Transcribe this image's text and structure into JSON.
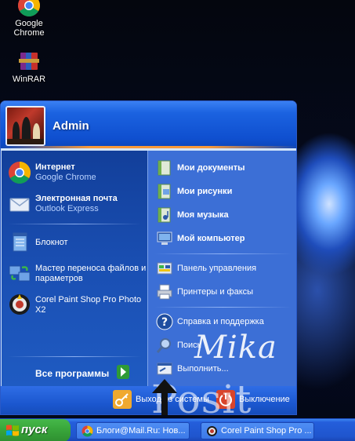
{
  "desktop": {
    "icons": [
      {
        "label": "Google Chrome"
      },
      {
        "label": "WinRAR"
      }
    ]
  },
  "start_menu": {
    "user": {
      "name": "Admin"
    },
    "left": {
      "internet": {
        "title": "Интернет",
        "sub": "Google Chrome"
      },
      "email": {
        "title": "Электронная почта",
        "sub": "Outlook Express"
      },
      "notepad": {
        "title": "Блокнот"
      },
      "transfer_wizard": {
        "line1": "Мастер переноса файлов и",
        "line2": "параметров"
      },
      "corel": {
        "line1": "Corel Paint Shop Pro Photo",
        "line2": "X2"
      },
      "all_programs": "Все программы"
    },
    "right": {
      "my_documents": "Мои документы",
      "my_pictures": "Мои рисунки",
      "my_music": "Моя музыка",
      "my_computer": "Мой компьютер",
      "control_panel": "Панель управления",
      "printers": "Принтеры и факсы",
      "help": "Справка и поддержка",
      "search": "Поиск",
      "run": "Выполнить..."
    },
    "footer": {
      "logoff_label": "Выход из системы",
      "shutdown_label": "Выключение"
    }
  },
  "taskbar": {
    "start_label": "пуск",
    "tasks": [
      {
        "label": "Блоги@Mail.Ru: Нов..."
      },
      {
        "label": "Corel Paint Shop Pro ..."
      }
    ]
  },
  "overlay": {
    "signature": "Mika",
    "site": "Posit"
  },
  "colors": {
    "menu_blue": "#3c6fd6",
    "left_pane": "#1a4fb3",
    "taskbar": "#245edb",
    "start_green": "#3aa83c"
  }
}
